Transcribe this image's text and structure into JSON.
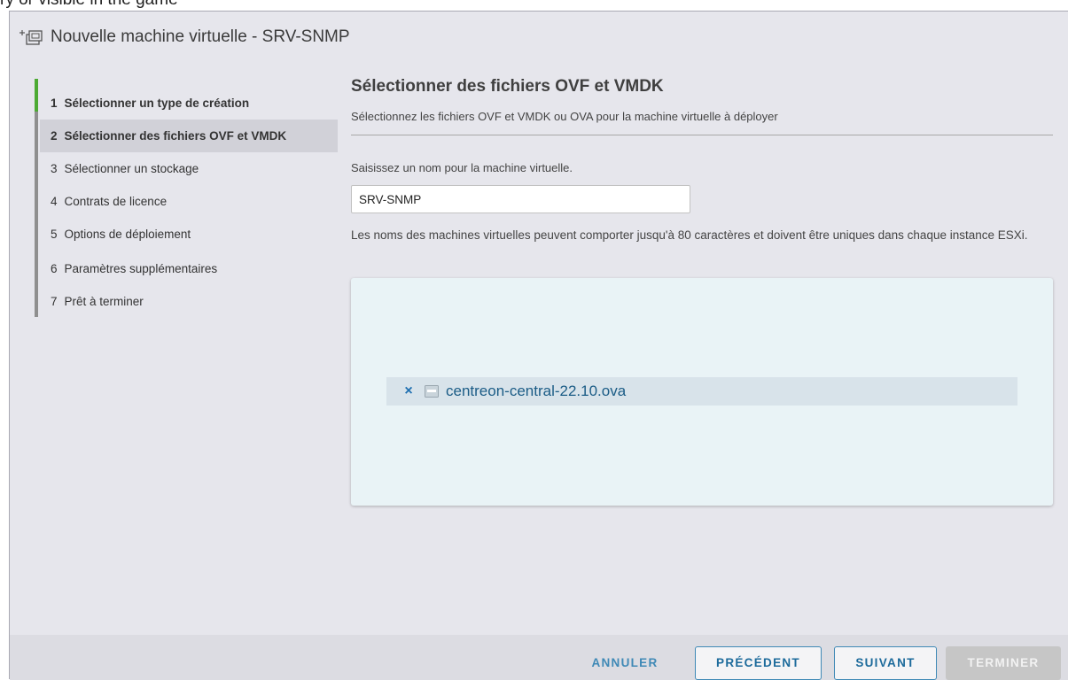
{
  "top_strip_text": "ry or visible in the game",
  "dialog": {
    "title": "Nouvelle machine virtuelle - SRV-SNMP"
  },
  "steps": [
    {
      "num": "1",
      "label": "Sélectionner un type de création",
      "state": "done"
    },
    {
      "num": "2",
      "label": "Sélectionner des fichiers OVF et VMDK",
      "state": "active"
    },
    {
      "num": "3",
      "label": "Sélectionner un stockage",
      "state": "pending"
    },
    {
      "num": "4",
      "label": "Contrats de licence",
      "state": "pending"
    },
    {
      "num": "5",
      "label": "Options de déploiement",
      "state": "pending"
    },
    {
      "num": "6",
      "label": "Paramètres supplémentaires",
      "state": "pending"
    },
    {
      "num": "7",
      "label": "Prêt à terminer",
      "state": "pending"
    }
  ],
  "content": {
    "title": "Sélectionner des fichiers OVF et VMDK",
    "subtitle": "Sélectionnez les fichiers OVF et VMDK ou OVA pour la machine virtuelle à déployer",
    "name_label": "Saisissez un nom pour la machine virtuelle.",
    "name_value": "SRV-SNMP",
    "name_help": "Les noms des machines virtuelles peuvent comporter jusqu'à 80 caractères et doivent être uniques dans chaque instance ESXi.",
    "files": [
      {
        "name": "centreon-central-22.10.ova",
        "remove_icon": "×"
      }
    ]
  },
  "footer": {
    "cancel_label": "ANNULER",
    "previous_label": "PRÉCÉDENT",
    "next_label": "SUIVANT",
    "finish_label": "TERMINER"
  },
  "colors": {
    "accent": "#3f89b6",
    "step_done": "#4caa33",
    "dropzone_bg": "#e9f3f6"
  }
}
